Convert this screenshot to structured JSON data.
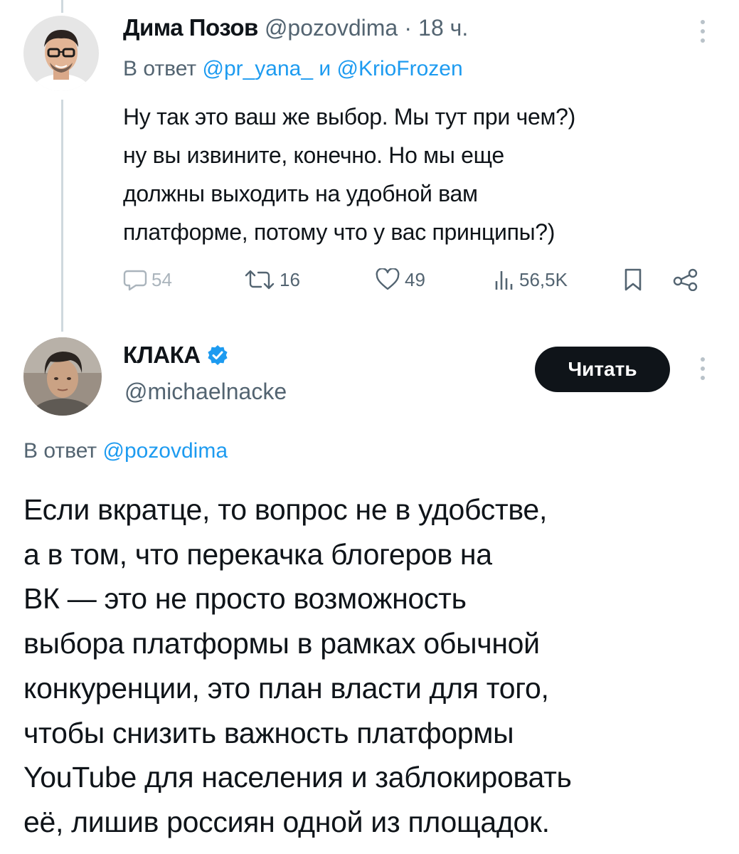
{
  "tweet1": {
    "author": {
      "name": "Дима Позов",
      "handle": "@pozovdima",
      "separator": "·",
      "time": "18 ч."
    },
    "reply": {
      "prefix": "В ответ",
      "mention1": "@pr_yana_",
      "conj": "и",
      "mention2": "@KrioFrozen"
    },
    "text": "Ну так это ваш же выбор. Мы тут при чем?)\nну вы извините, конечно. Но мы еще\nдолжны выходить на удобной вам\nплатформе, потому что у вас принципы?)",
    "actions": {
      "replies": "54",
      "reposts": "16",
      "likes": "49",
      "views": "56,5K"
    }
  },
  "tweet2": {
    "author": {
      "name": "КЛАКА",
      "handle": "@michaelnacke",
      "verified": true
    },
    "follow_label": "Читать",
    "reply": {
      "prefix": "В ответ",
      "mention1": "@pozovdima"
    },
    "text": "Если вкратце, то вопрос не в удобстве,\nа в том, что перекачка блогеров на\nВК — это не просто возможность\nвыбора платформы в рамках обычной\nконкуренции, это план власти для того,\nчтобы снизить важность платформы\nYouTube для населения и заблокировать\nеё, лишив россиян одной из площадок."
  },
  "colors": {
    "link": "#1d9bf0",
    "muted": "#536471",
    "verified": "#1d9bf0",
    "thread_line": "#cfd9de"
  }
}
